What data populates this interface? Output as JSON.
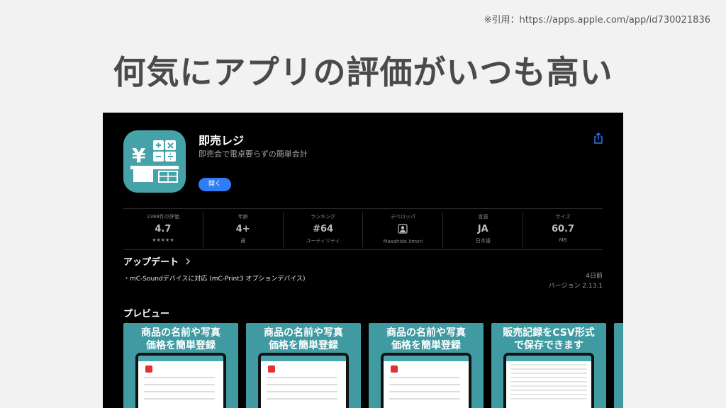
{
  "citation": "※引用：https://apps.apple.com/app/id730021836",
  "slide_title": "何気にアプリの評価がいつも高い",
  "app": {
    "name": "即売レジ",
    "subtitle": "即売会で電卓要らずの簡単会計",
    "open_label": "開く",
    "icon_color": "#45a2a8",
    "icon": "yen-calculator-register-icon"
  },
  "stats": [
    {
      "label": "2388件の評価",
      "value": "4.7",
      "sub": "★★★★★"
    },
    {
      "label": "年齢",
      "value": "4+",
      "sub": "歳"
    },
    {
      "label": "ランキング",
      "value": "#64",
      "sub": "ユーティリティ"
    },
    {
      "label": "デベロッパ",
      "value": "",
      "sub": "Masahide Iimori",
      "icon": "developer-person-icon"
    },
    {
      "label": "言語",
      "value": "JA",
      "sub": "日本語"
    },
    {
      "label": "サイズ",
      "value": "60.7",
      "sub": "MB"
    }
  ],
  "update": {
    "title": "アップデート",
    "item": "・mC-Soundデバイスに対応 (mC-Print3 オプションデバイス)",
    "date": "4日前",
    "version": "バージョン 2.13.1"
  },
  "preview": {
    "title": "プレビュー",
    "cards": [
      {
        "line1": "商品の名前や写真",
        "line2": "価格を簡単登録"
      },
      {
        "line1": "商品の名前や写真",
        "line2": "価格を簡単登録"
      },
      {
        "line1": "商品の名前や写真",
        "line2": "価格を簡単登録"
      },
      {
        "line1": "販売記録をCSV形式",
        "line2": "で保存できます"
      }
    ]
  },
  "colors": {
    "accent_blue": "#2f7df6",
    "preview_teal": "#3f9aa2"
  }
}
